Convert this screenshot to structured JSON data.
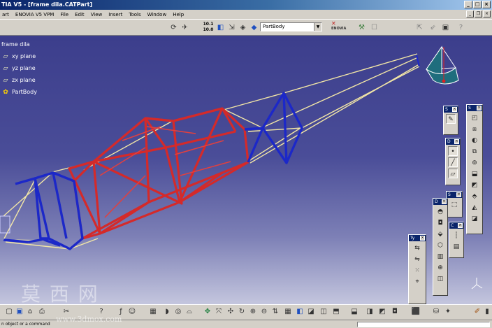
{
  "window": {
    "title": "TIA V5 - [frame dila.CATPart]"
  },
  "menu": {
    "items": [
      "art",
      "ENOVIA V5 VPM",
      "File",
      "Edit",
      "View",
      "Insert",
      "Tools",
      "Window",
      "Help"
    ]
  },
  "toolbar_top": {
    "scale_top": "10.1",
    "scale_bottom": "10.0",
    "part_select_value": "PartBody",
    "enovia_label": "ENOVIA"
  },
  "tree": {
    "items": [
      {
        "label": "frame dila",
        "icon": "part-icon"
      },
      {
        "label": "xy plane",
        "icon": "plane-icon"
      },
      {
        "label": "yz plane",
        "icon": "plane-icon"
      },
      {
        "label": "zx plane",
        "icon": "plane-icon"
      },
      {
        "label": "PartBody",
        "icon": "partbody-icon"
      }
    ]
  },
  "panels": {
    "sketcher_title": "S",
    "sketcher2_title": "S",
    "dress_title": "D",
    "ref_title": "D",
    "sk3_title": "S",
    "constraint_title": "C",
    "tools_title": "Ty"
  },
  "statusbar": {
    "message": "n object or a command"
  },
  "watermark": {
    "chinese": "莫 西 网",
    "url": "www.3dmox.com"
  },
  "colors": {
    "viewport_top": "#3c3e8c",
    "viewport_bottom": "#c4c6de",
    "frame_red": "#d42a2a",
    "frame_blue": "#1c28c8",
    "frame_yellow": "#f2e6a6"
  }
}
